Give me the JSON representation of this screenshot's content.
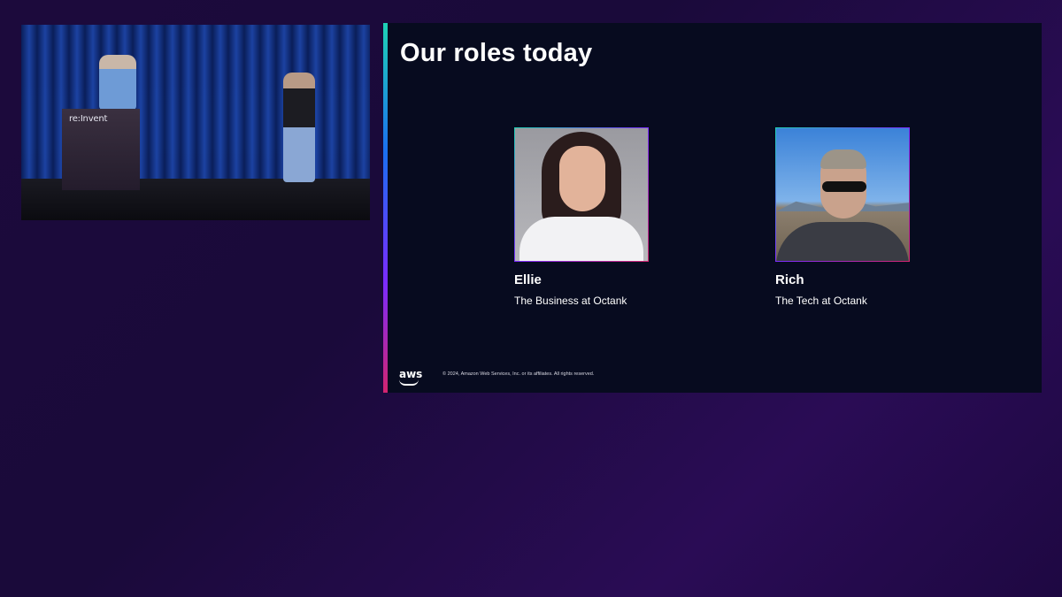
{
  "stage_video": {
    "podium_logo": "re:Invent"
  },
  "slide": {
    "title": "Our roles today",
    "presenters": [
      {
        "name": "Ellie",
        "role": "The Business at Octank"
      },
      {
        "name": "Rich",
        "role": "The Tech at Octank"
      }
    ],
    "footer": {
      "logo": "aws",
      "copyright": "© 2024, Amazon Web Services, Inc. or its affiliates. All rights reserved."
    },
    "accent_colors": [
      "#1ed2b5",
      "#1b6ff0",
      "#7a2cff",
      "#d2246f"
    ]
  },
  "background_color": "#1c0a3c"
}
